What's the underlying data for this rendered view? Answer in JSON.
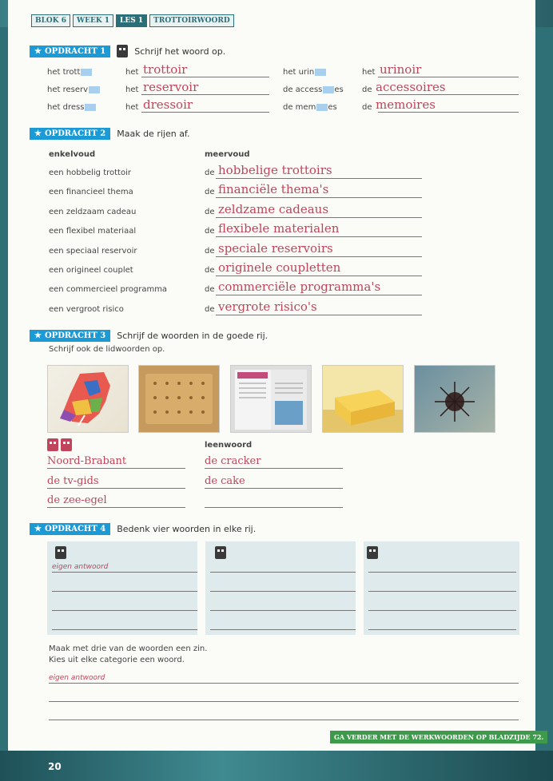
{
  "breadcrumbs": [
    "BLOK 6",
    "WEEK 1",
    "LES 1",
    "TROTTOIRWOORD"
  ],
  "page_number": "20",
  "footer_note": "GA VERDER MET DE WERKWOORDEN OP BLADZIJDE 72.",
  "ex1": {
    "label": "OPDRACHT 1",
    "instruction": "Schrijf het woord op.",
    "rows": [
      [
        {
          "prompt_pre": "het trott",
          "prompt_post": "",
          "article": "het",
          "answer": "trottoir"
        },
        {
          "prompt_pre": "het urin",
          "prompt_post": "",
          "article": "het",
          "answer": "urinoir"
        }
      ],
      [
        {
          "prompt_pre": "het reserv",
          "prompt_post": "",
          "article": "het",
          "answer": "reservoir"
        },
        {
          "prompt_pre": "de access",
          "prompt_post": "es",
          "article": "de",
          "answer": "accessoires"
        }
      ],
      [
        {
          "prompt_pre": "het dress",
          "prompt_post": "",
          "article": "het",
          "answer": "dressoir"
        },
        {
          "prompt_pre": "de mem",
          "prompt_post": "es",
          "article": "de",
          "answer": "memoires"
        }
      ]
    ]
  },
  "ex2": {
    "label": "OPDRACHT 2",
    "instruction": "Maak de rijen af.",
    "col1": "enkelvoud",
    "col2": "meervoud",
    "rows": [
      {
        "singular": "een hobbelig trottoir",
        "article": "de",
        "answer": "hobbelige trottoirs"
      },
      {
        "singular": "een financieel thema",
        "article": "de",
        "answer": "financiële thema's"
      },
      {
        "singular": "een zeldzaam cadeau",
        "article": "de",
        "answer": "zeldzame cadeaus"
      },
      {
        "singular": "een flexibel materiaal",
        "article": "de",
        "answer": "flexibele materialen"
      },
      {
        "singular": "een speciaal reservoir",
        "article": "de",
        "answer": "speciale reservoirs"
      },
      {
        "singular": "een origineel couplet",
        "article": "de",
        "answer": "originele coupletten"
      },
      {
        "singular": "een commercieel programma",
        "article": "de",
        "answer": "commerciële programma's"
      },
      {
        "singular": "een vergroot risico",
        "article": "de",
        "answer": "vergrote risico's"
      }
    ]
  },
  "ex3": {
    "label": "OPDRACHT 3",
    "instruction1": "Schrijf de woorden in de goede rij.",
    "instruction2": "Schrijf ook de lidwoorden op.",
    "col2": "leenwoord",
    "col1_answers": [
      "Noord-Brabant",
      "de tv-gids",
      "de zee-egel"
    ],
    "col2_answers": [
      "de cracker",
      "de cake",
      ""
    ],
    "photos": [
      "map-photo",
      "cracker-photo",
      "tv-guide-photo",
      "cake-photo",
      "sea-urchin-photo"
    ]
  },
  "ex4": {
    "label": "OPDRACHT 4",
    "instruction": "Bedenk vier woorden in elke rij.",
    "first_answer": "eigen antwoord",
    "sentence_instruction1": "Maak met drie van de woorden een zin.",
    "sentence_instruction2": "Kies uit elke categorie een woord.",
    "sentence_answer": "eigen antwoord"
  },
  "colors": {
    "accent": "#1b9ad6",
    "answer": "#c0455a",
    "band": "#2f6f76",
    "footer": "#3d9a4a"
  }
}
